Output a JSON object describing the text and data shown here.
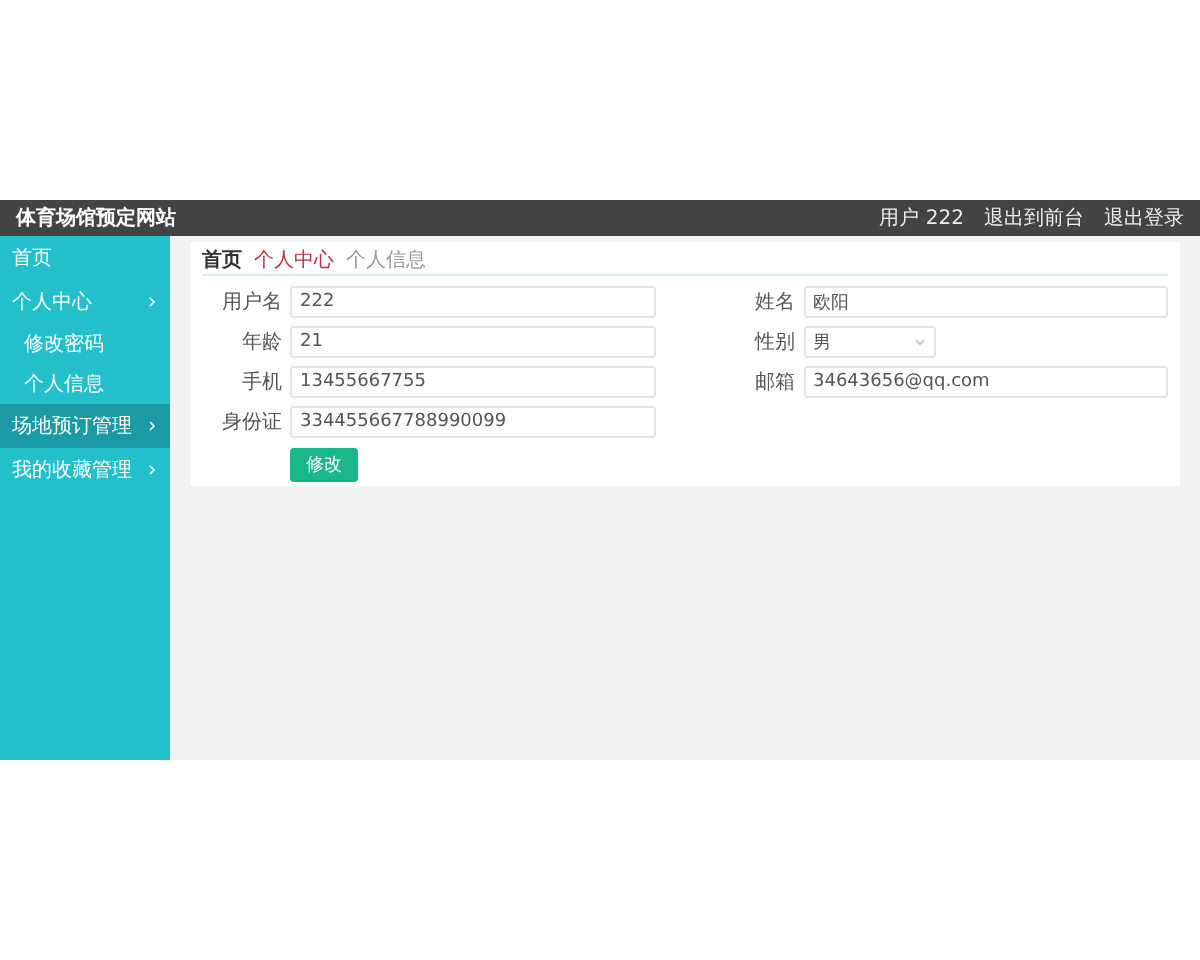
{
  "header": {
    "title": "体育场馆预定网站",
    "user": "用户 222",
    "links": [
      "退出到前台",
      "退出登录"
    ]
  },
  "sidebar": {
    "items": [
      {
        "label": "首页",
        "kind": "link",
        "selected": false
      },
      {
        "label": "个人中心",
        "kind": "menu",
        "selected": false,
        "children": [
          {
            "label": "修改密码",
            "selected": false
          },
          {
            "label": "个人信息",
            "selected": false
          }
        ]
      },
      {
        "label": "场地预订管理",
        "kind": "menu",
        "selected": true
      },
      {
        "label": "我的收藏管理",
        "kind": "menu",
        "selected": false
      }
    ]
  },
  "breadcrumb": [
    "首页",
    "个人中心",
    "个人信息"
  ],
  "form": {
    "fields": [
      {
        "label": "用户名",
        "value": "222",
        "kind": "input"
      },
      {
        "label": "姓名",
        "value": "欧阳",
        "kind": "input"
      },
      {
        "label": "年龄",
        "value": "21",
        "kind": "input"
      },
      {
        "label": "性别",
        "value": "男",
        "kind": "select"
      },
      {
        "label": "手机",
        "value": "13455667755",
        "kind": "input"
      },
      {
        "label": "邮箱",
        "value": "34643656@qq.com",
        "kind": "input"
      },
      {
        "label": "身份证",
        "value": "334455667788990099",
        "kind": "input"
      }
    ],
    "button": "修改"
  }
}
